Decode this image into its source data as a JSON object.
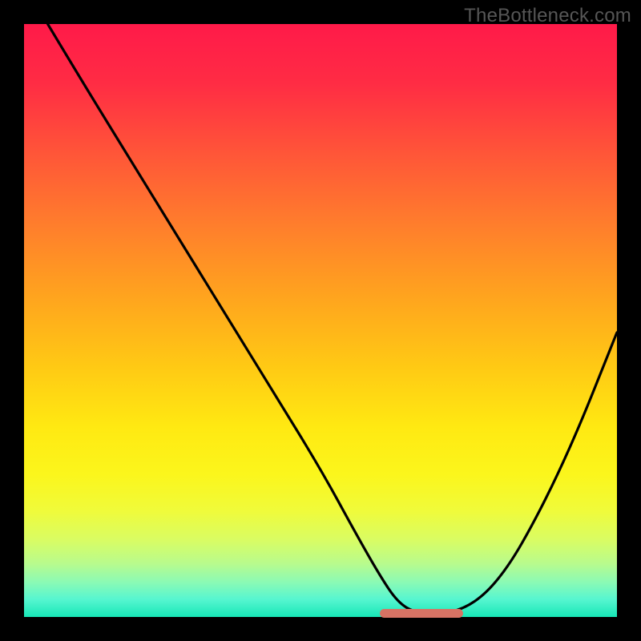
{
  "watermark": "TheBottleneck.com",
  "chart_data": {
    "type": "line",
    "title": "",
    "xlabel": "",
    "ylabel": "",
    "xlim": [
      0,
      100
    ],
    "ylim": [
      0,
      100
    ],
    "grid": false,
    "legend": false,
    "series": [
      {
        "name": "curve",
        "x": [
          4,
          10,
          18,
          26,
          34,
          42,
          50,
          56,
          60,
          63,
          66,
          70,
          74,
          78,
          82,
          86,
          90,
          94,
          98,
          100
        ],
        "values": [
          100,
          90,
          77,
          64,
          51,
          38,
          25,
          14,
          7,
          2.5,
          0.7,
          0.5,
          1.3,
          4,
          9,
          16,
          24,
          33,
          43,
          48
        ]
      }
    ],
    "markers": [
      {
        "name": "optimal-range",
        "x_start": 60,
        "x_end": 74,
        "y": 0.6
      }
    ],
    "gradient_stops": [
      {
        "pos": 0,
        "color": "#ff1a49"
      },
      {
        "pos": 50,
        "color": "#ffca14"
      },
      {
        "pos": 80,
        "color": "#f0fb3a"
      },
      {
        "pos": 100,
        "color": "#17e7b7"
      }
    ]
  }
}
